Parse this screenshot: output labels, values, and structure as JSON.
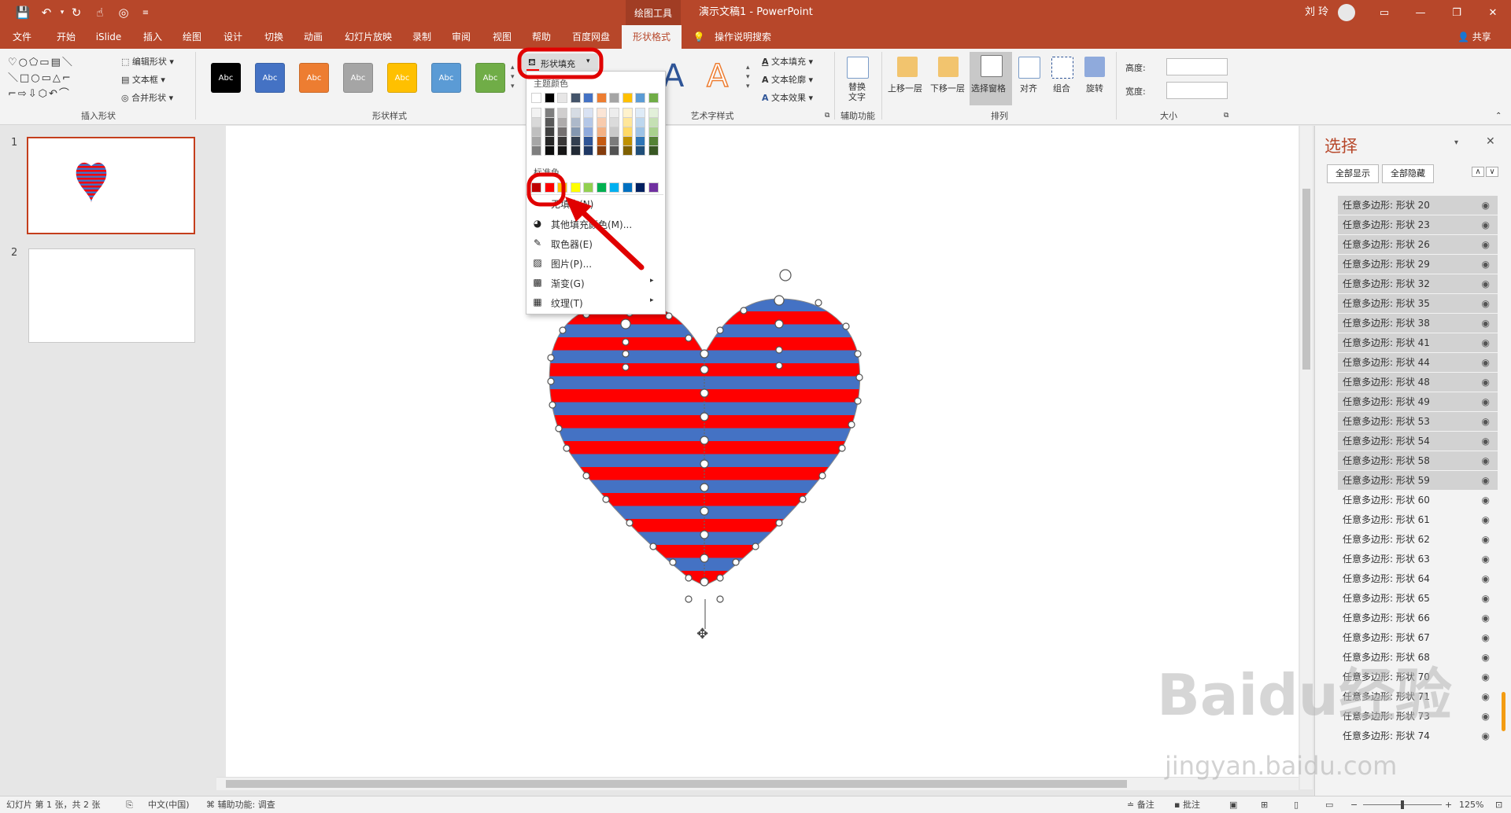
{
  "title_bar": {
    "context_tab_group": "绘图工具",
    "document_title": "演示文稿1  -  PowerPoint",
    "user_name": "刘 玲",
    "quick_access": [
      "save-icon",
      "undo-icon",
      "undo-dropdown-icon",
      "redo-icon",
      "touch-mode-icon",
      "paint-icon",
      "customize-icon"
    ]
  },
  "tabs": [
    "文件",
    "开始",
    "iSlide",
    "插入",
    "绘图",
    "设计",
    "切换",
    "动画",
    "幻灯片放映",
    "录制",
    "审阅",
    "视图",
    "帮助",
    "百度网盘",
    "形状格式",
    "操作说明搜索"
  ],
  "active_tab": "形状格式",
  "share_label": "共享",
  "ribbon": {
    "insert_shapes": {
      "label": "插入形状",
      "edit_shape": "编辑形状",
      "text_box": "文本框",
      "merge_shapes": "合并形状"
    },
    "shape_styles": {
      "label": "形状样式",
      "preview": "Abc",
      "colors": [
        "#000000",
        "#4472c4",
        "#ed7d31",
        "#a5a5a5",
        "#ffc000",
        "#5b9bd5",
        "#70ad47"
      ],
      "shape_fill": "形状填充"
    },
    "wordart": {
      "label": "艺术字样式",
      "big_a": "A",
      "text_fill": "文本填充",
      "text_outline": "文本轮廓",
      "text_effect": "文本效果"
    },
    "accessibility": {
      "label": "辅助功能",
      "alt_text": "替换\n文字"
    },
    "arrange": {
      "label": "排列",
      "bring_forward": "上移一层",
      "send_backward": "下移一层",
      "selection_pane": "选择窗格",
      "align": "对齐",
      "group": "组合",
      "rotate": "旋转"
    },
    "size": {
      "label": "大小",
      "height": "高度:",
      "width": "宽度:"
    }
  },
  "fill_dropdown": {
    "theme_colors_label": "主题颜色",
    "standard_colors_label": "标准色",
    "theme_top_row": [
      "#ffffff",
      "#000000",
      "#e7e6e6",
      "#44546a",
      "#4472c4",
      "#ed7d31",
      "#a5a5a5",
      "#ffc000",
      "#5b9bd5",
      "#70ad47"
    ],
    "theme_shades": [
      [
        "#f2f2f2",
        "#7f7f7f",
        "#d0cece",
        "#d6dce4",
        "#d9e2f3",
        "#fbe5d6",
        "#ededed",
        "#fff2cc",
        "#deebf7",
        "#e2f0d9"
      ],
      [
        "#d9d9d9",
        "#595959",
        "#aeabab",
        "#adb9ca",
        "#b4c7e7",
        "#f8cbad",
        "#dbdbdb",
        "#ffe699",
        "#bdd7ee",
        "#c5e0b4"
      ],
      [
        "#bfbfbf",
        "#404040",
        "#757171",
        "#8497b0",
        "#8faadc",
        "#f4b183",
        "#c9c9c9",
        "#ffd966",
        "#9dc3e6",
        "#a9d18e"
      ],
      [
        "#a6a6a6",
        "#262626",
        "#3a3838",
        "#333f50",
        "#2f5597",
        "#c55a11",
        "#7b7b7b",
        "#bf9000",
        "#2e75b6",
        "#548235"
      ],
      [
        "#7f7f7f",
        "#0d0d0d",
        "#171616",
        "#222a35",
        "#1f3864",
        "#843c0c",
        "#525252",
        "#7f6000",
        "#1f4e79",
        "#385723"
      ]
    ],
    "standard": [
      "#c00000",
      "#ff0000",
      "#ffc000",
      "#ffff00",
      "#92d050",
      "#00b050",
      "#00b0f0",
      "#0070c0",
      "#002060",
      "#7030a0"
    ],
    "no_fill": "无填充(N)",
    "items": [
      {
        "icon": "color-wheel-icon",
        "label": "其他填充颜色(M)..."
      },
      {
        "icon": "eyedropper-icon",
        "label": "取色器(E)"
      },
      {
        "icon": "picture-icon",
        "label": "图片(P)..."
      },
      {
        "icon": "gradient-icon",
        "label": "渐变(G)"
      },
      {
        "icon": "texture-icon",
        "label": "纹理(T)"
      }
    ]
  },
  "slides": [
    {
      "number": "1"
    },
    {
      "number": "2"
    }
  ],
  "selection_pane": {
    "title": "选择",
    "show_all": "全部显示",
    "hide_all": "全部隐藏",
    "items": [
      {
        "name": "任意多边形: 形状 20",
        "selected": true
      },
      {
        "name": "任意多边形: 形状 23",
        "selected": true
      },
      {
        "name": "任意多边形: 形状 26",
        "selected": true
      },
      {
        "name": "任意多边形: 形状 29",
        "selected": true
      },
      {
        "name": "任意多边形: 形状 32",
        "selected": true
      },
      {
        "name": "任意多边形: 形状 35",
        "selected": true
      },
      {
        "name": "任意多边形: 形状 38",
        "selected": true
      },
      {
        "name": "任意多边形: 形状 41",
        "selected": true
      },
      {
        "name": "任意多边形: 形状 44",
        "selected": true
      },
      {
        "name": "任意多边形: 形状 48",
        "selected": true
      },
      {
        "name": "任意多边形: 形状 49",
        "selected": true
      },
      {
        "name": "任意多边形: 形状 53",
        "selected": true
      },
      {
        "name": "任意多边形: 形状 54",
        "selected": true
      },
      {
        "name": "任意多边形: 形状 58",
        "selected": true
      },
      {
        "name": "任意多边形: 形状 59",
        "selected": true
      },
      {
        "name": "任意多边形: 形状 60",
        "selected": false
      },
      {
        "name": "任意多边形: 形状 61",
        "selected": false
      },
      {
        "name": "任意多边形: 形状 62",
        "selected": false
      },
      {
        "name": "任意多边形: 形状 63",
        "selected": false
      },
      {
        "name": "任意多边形: 形状 64",
        "selected": false
      },
      {
        "name": "任意多边形: 形状 65",
        "selected": false
      },
      {
        "name": "任意多边形: 形状 66",
        "selected": false
      },
      {
        "name": "任意多边形: 形状 67",
        "selected": false
      },
      {
        "name": "任意多边形: 形状 68",
        "selected": false
      },
      {
        "name": "任意多边形: 形状 70",
        "selected": false
      },
      {
        "name": "任意多边形: 形状 71",
        "selected": false
      },
      {
        "name": "任意多边形: 形状 73",
        "selected": false
      },
      {
        "name": "任意多边形: 形状 74",
        "selected": false
      }
    ]
  },
  "status_bar": {
    "slide_info": "幻灯片 第 1 张，共 2 张",
    "language": "中文(中国)",
    "accessibility": "辅助功能: 调查",
    "notes": "备注",
    "comments": "批注",
    "zoom": "125%"
  },
  "colors": {
    "accent": "#b7472a",
    "stripe_red": "#ff0000",
    "stripe_blue": "#4472c4",
    "annotation": "#e00000"
  },
  "watermark": {
    "logo": "Baidu经验",
    "url": "jingyan.baidu.com"
  }
}
